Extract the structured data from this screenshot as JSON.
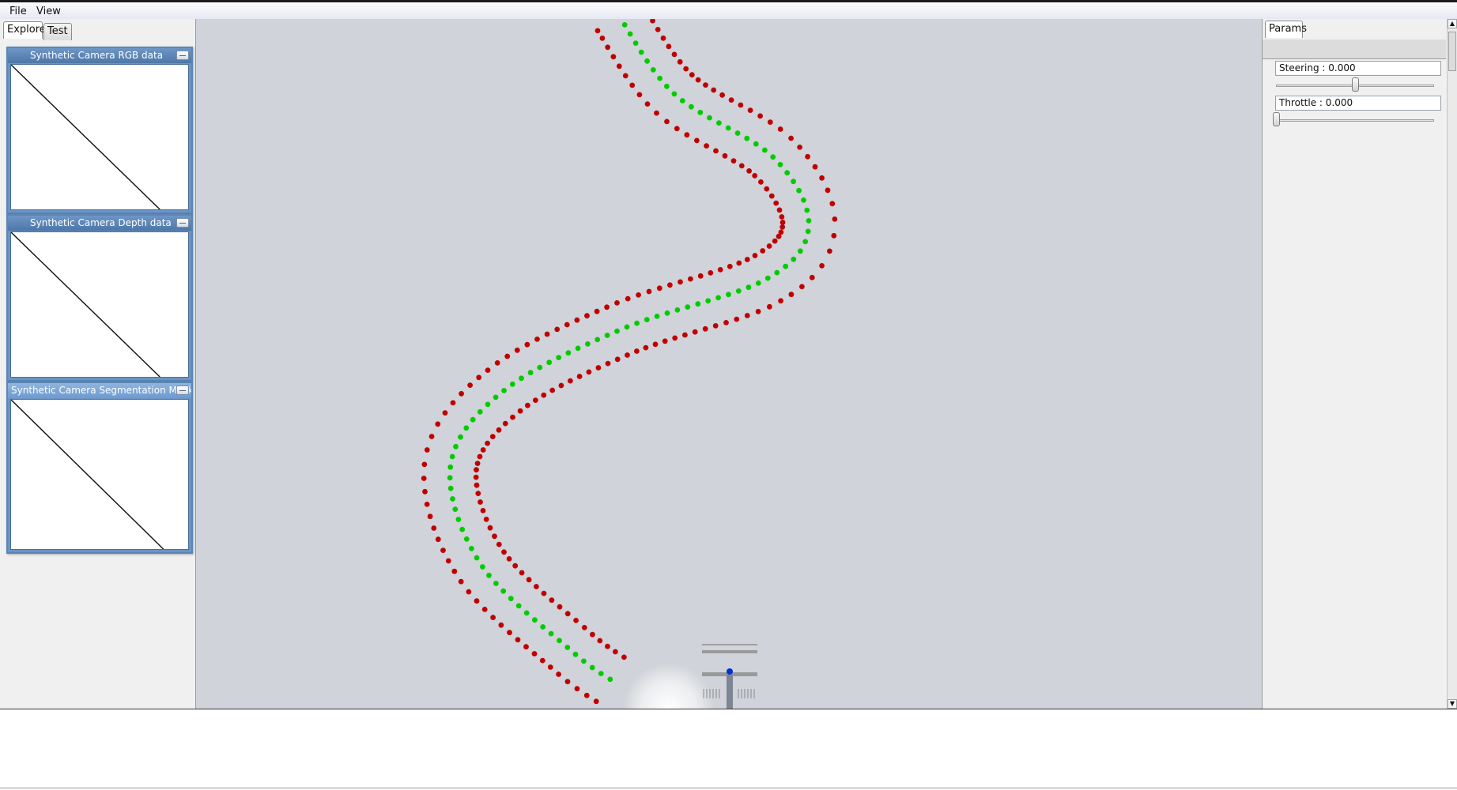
{
  "menubar": {
    "file": "File",
    "view": "View"
  },
  "left_panel": {
    "tabs": [
      "Explorer",
      "Test"
    ],
    "windows": [
      {
        "title": "Synthetic Camera RGB data"
      },
      {
        "title": "Synthetic Camera Depth data"
      },
      {
        "title": "Synthetic Camera Segmentation Mask"
      }
    ]
  },
  "right_panel": {
    "tab": "Params",
    "steering": {
      "label": "Steering : 0.000",
      "value": 0.0,
      "min": -1,
      "max": 1
    },
    "throttle": {
      "label": "Throttle : 0.000",
      "value": 0.0,
      "min": 0,
      "max": 1
    }
  },
  "viewport": {
    "colors": {
      "boundary": "#c00000",
      "centerline": "#00cc00",
      "vehicle": "#0033cc",
      "background": "#d0d3d9"
    }
  }
}
